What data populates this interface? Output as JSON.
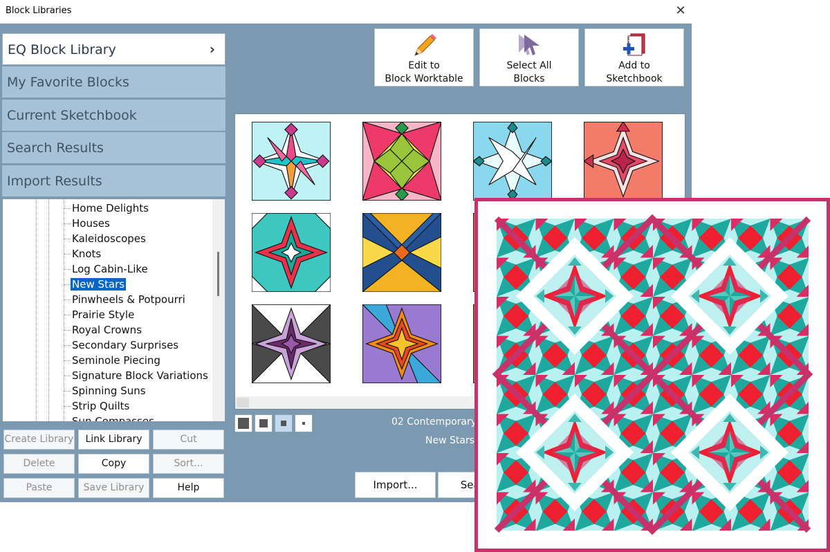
{
  "window": {
    "title": "Block Libraries",
    "close_glyph": "✕"
  },
  "libraries": {
    "items": [
      {
        "label": "EQ Block Library",
        "active": true,
        "chevron": "›"
      },
      {
        "label": "My Favorite Blocks"
      },
      {
        "label": "Current Sketchbook"
      },
      {
        "label": "Search Results"
      },
      {
        "label": "Import Results"
      }
    ]
  },
  "tree": {
    "items": [
      "Home Delights",
      "Houses",
      "Kaleidoscopes",
      "Knots",
      "Log Cabin-Like",
      "New Stars",
      "Pinwheels & Potpourri",
      "Prairie Style",
      "Royal Crowns",
      "Secondary Surprises",
      "Seminole Piecing",
      "Signature Block Variations",
      "Spinning Suns",
      "Strip Quilts",
      "Sun Compasses"
    ],
    "selected": "New Stars"
  },
  "side_buttons": {
    "create_library": "Create Library",
    "link_library": "Link Library",
    "cut": "Cut",
    "delete": "Delete",
    "copy": "Copy",
    "sort": "Sort...",
    "paste": "Paste",
    "save_library": "Save Library",
    "help": "Help"
  },
  "toolbar": {
    "edit": {
      "line1": "Edit to",
      "line2": "Block Worktable",
      "icon": "pencil-icon"
    },
    "select_all": {
      "line1": "Select All",
      "line2": "Blocks",
      "icon": "cursor-icon"
    },
    "add": {
      "line1": "Add to",
      "line2": "Sketchbook",
      "icon": "sketchbook-add-icon"
    }
  },
  "block_info": {
    "category": "02 Contemporary",
    "style": "New Stars"
  },
  "bottom_buttons": {
    "import": "Import...",
    "search": "Search"
  },
  "colors": {
    "window_bg": "#7b99b1",
    "quilt_border": "#c8326a",
    "selection": "#0a64c8"
  }
}
